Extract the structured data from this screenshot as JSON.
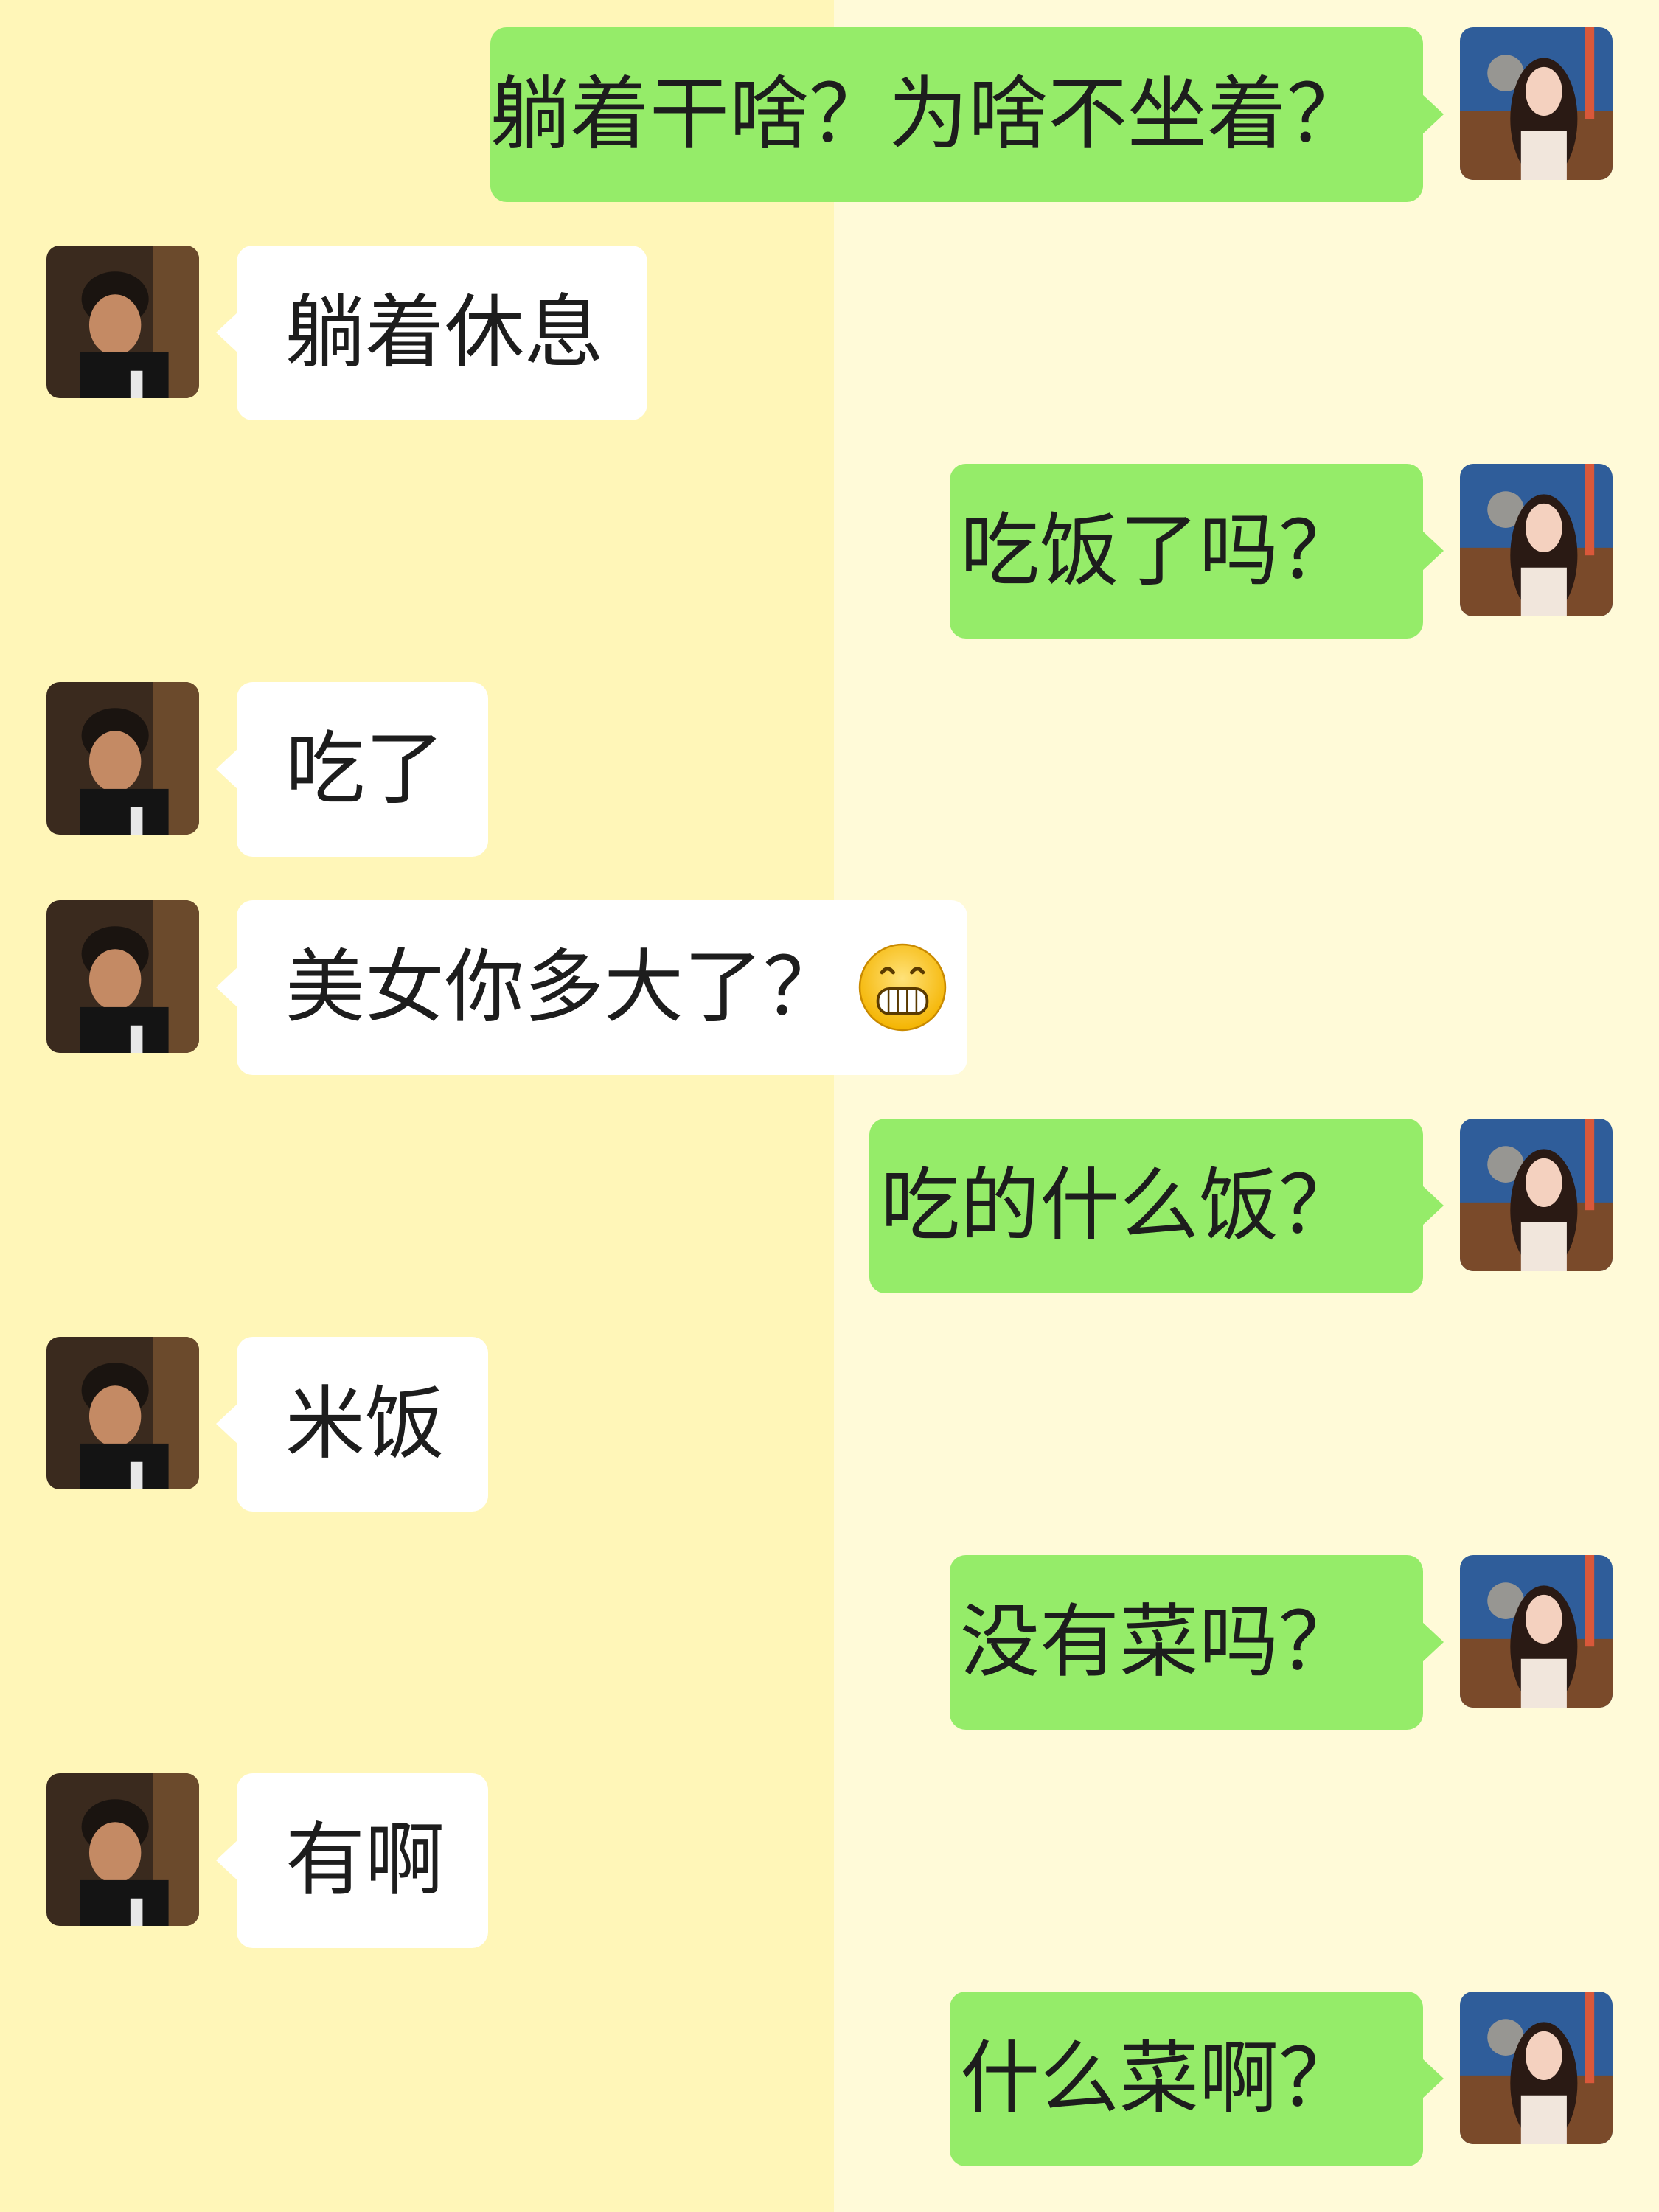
{
  "chat": {
    "messages": [
      {
        "sender": "self",
        "text": "躺着干啥？为啥不坐着？"
      },
      {
        "sender": "other",
        "text": "躺着休息"
      },
      {
        "sender": "self",
        "text": "吃饭了吗？"
      },
      {
        "sender": "other",
        "text": "吃了"
      },
      {
        "sender": "other",
        "text": "美女你多大了？",
        "emoji": "grinning-face-icon"
      },
      {
        "sender": "self",
        "text": "吃的什么饭？"
      },
      {
        "sender": "other",
        "text": "米饭"
      },
      {
        "sender": "self",
        "text": "没有菜吗？"
      },
      {
        "sender": "other",
        "text": "有啊"
      },
      {
        "sender": "self",
        "text": "什么菜啊？"
      }
    ]
  },
  "colors": {
    "left_background": "#fff6b8",
    "right_background": "#fffad8",
    "sent_bubble": "#95ec69",
    "received_bubble": "#ffffff"
  }
}
